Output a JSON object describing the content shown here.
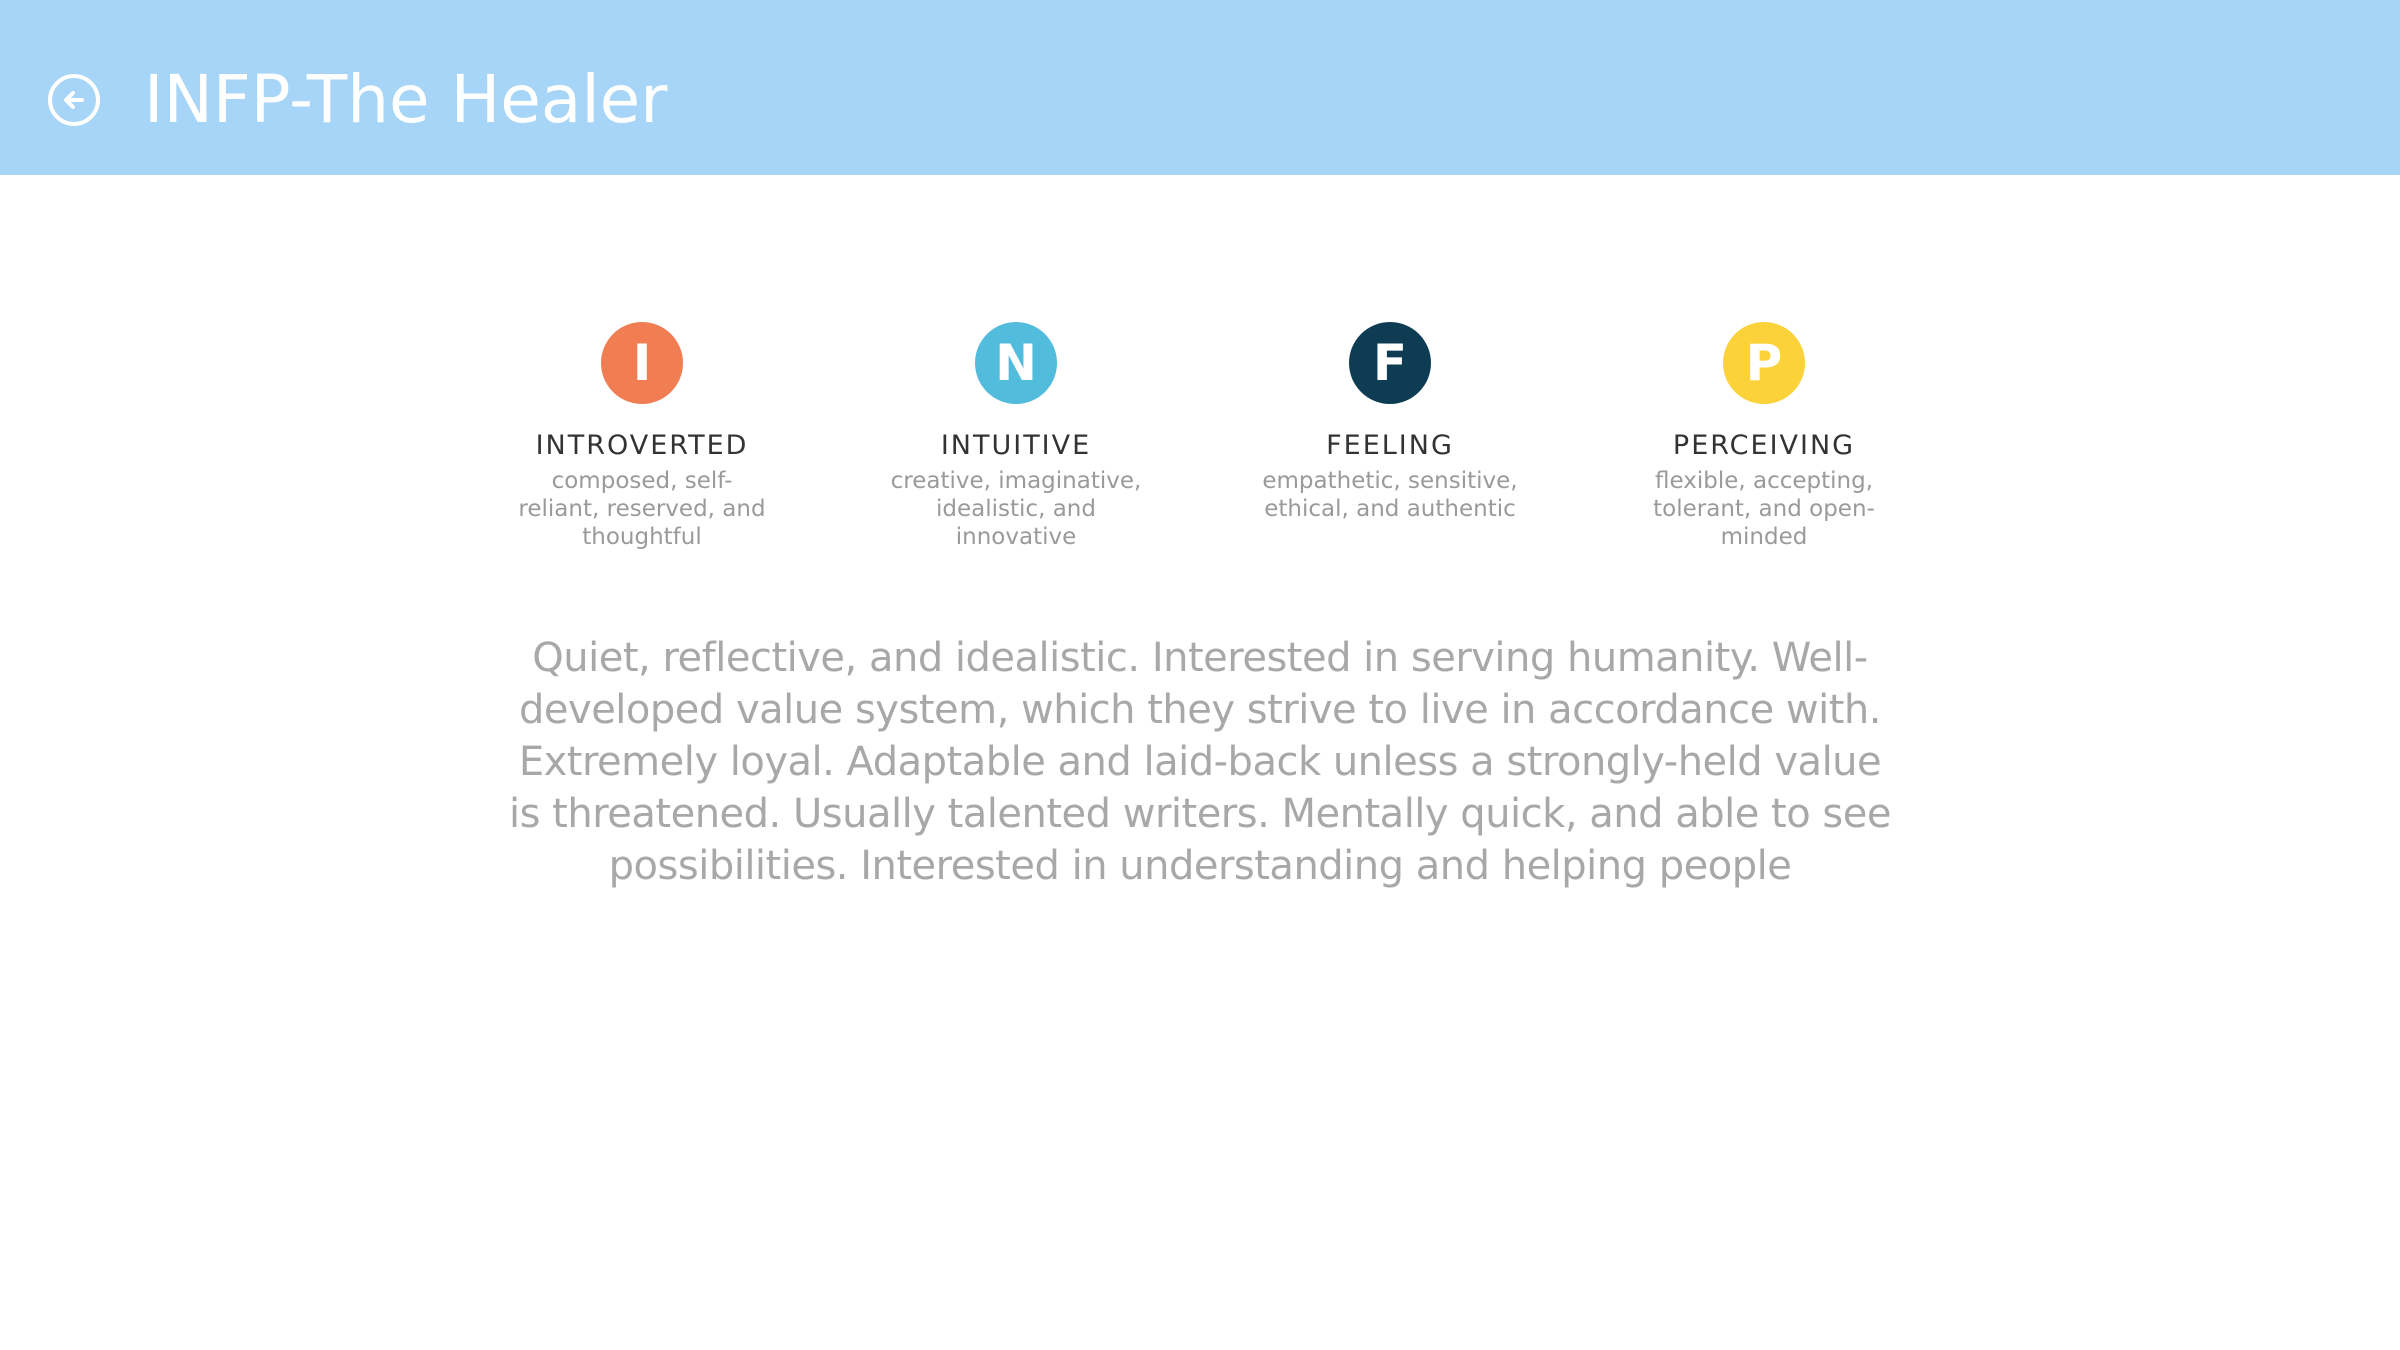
{
  "header": {
    "back_icon": "arrow-left-circle-icon",
    "title": "INFP-The Healer"
  },
  "traits": [
    {
      "letter": "I",
      "name": "INTROVERTED",
      "description": "composed, self-reliant, reserved, and thoughtful",
      "color": "#f17d52"
    },
    {
      "letter": "N",
      "name": "INTUITIVE",
      "description": "creative, imaginative, idealistic, and innovative",
      "color": "#52bcdc"
    },
    {
      "letter": "F",
      "name": "FEELING",
      "description": "empathetic, sensitive, ethical, and authentic",
      "color": "#0d3c53"
    },
    {
      "letter": "P",
      "name": "PERCEIVING",
      "description": "flexible, accepting, tolerant, and open-minded",
      "color": "#fbd23a"
    }
  ],
  "description": "Quiet, reflective, and idealistic. Interested in serving humanity. Well-developed value system, which they strive to live in accordance with. Extremely loyal. Adaptable and laid-back unless a strongly-held value is threatened. Usually talented writers. Mentally quick, and able to see possibilities. Interested in understanding and helping people",
  "colors": {
    "header_background": "#a6d5f7",
    "header_text": "#ffffff",
    "body_text": "#a8a8a8"
  }
}
